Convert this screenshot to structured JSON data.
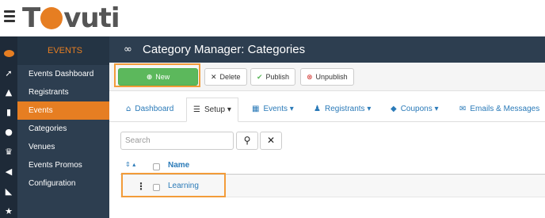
{
  "brand": {
    "logo_pre": "T",
    "logo_post": "vuti"
  },
  "colors": {
    "accent": "#e67e22",
    "sidebar": "#2d3e50",
    "new_button": "#5cb85c",
    "link": "#2a7ab8"
  },
  "rail_icons": [
    "tovuti-badge-icon",
    "rocket-icon",
    "graduation-cap-icon",
    "bar-chart-icon",
    "users-icon",
    "trophy-icon",
    "megaphone-icon",
    "rss-icon",
    "star-icon"
  ],
  "sidebar": {
    "header": "EVENTS",
    "items": [
      {
        "label": "Events Dashboard"
      },
      {
        "label": "Registrants"
      },
      {
        "label": "Events"
      },
      {
        "label": "Categories"
      },
      {
        "label": "Venues"
      },
      {
        "label": "Events Promos"
      },
      {
        "label": "Configuration"
      }
    ]
  },
  "page": {
    "title": "Category Manager: Categories"
  },
  "toolbar": {
    "new": "New",
    "delete": "Delete",
    "publish": "Publish",
    "unpublish": "Unpublish"
  },
  "tabs": [
    {
      "label": "Dashboard"
    },
    {
      "label": "Setup"
    },
    {
      "label": "Events"
    },
    {
      "label": "Registrants"
    },
    {
      "label": "Coupons"
    },
    {
      "label": "Emails & Messages"
    }
  ],
  "search": {
    "placeholder": "Search"
  },
  "table": {
    "columns": {
      "name": "Name"
    },
    "rows": [
      {
        "name": "Learning"
      }
    ]
  }
}
